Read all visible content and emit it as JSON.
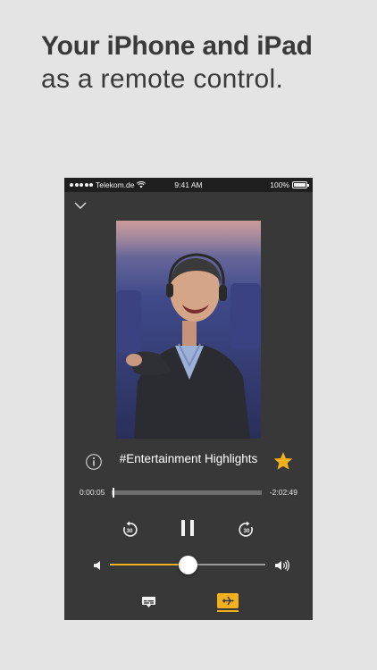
{
  "headline": {
    "line1": "Your iPhone and iPad",
    "line2": "as a remote control."
  },
  "status_bar": {
    "carrier": "Telekom.de",
    "time": "9:41 AM",
    "battery": "100%"
  },
  "player": {
    "title": "#Entertainment Highlights",
    "elapsed": "0:00:05",
    "remaining": "-2:02:49",
    "progress_fraction": 0.005,
    "volume_fraction": 0.5,
    "favorite": true,
    "rewind_label": "30",
    "forward_label": "30"
  },
  "icons": {
    "collapse": "chevron-down-icon",
    "info": "info-icon",
    "favorite": "star-icon",
    "rewind": "rewind-30-icon",
    "pause": "pause-icon",
    "forward": "forward-30-icon",
    "volume_low": "speaker-low-icon",
    "volume_high": "speaker-high-icon",
    "subtitles": "subtitles-icon",
    "flight": "airplane-icon"
  },
  "colors": {
    "accent": "#f2b01e",
    "player_background": "#383838",
    "page_background": "#e4e4e4"
  }
}
